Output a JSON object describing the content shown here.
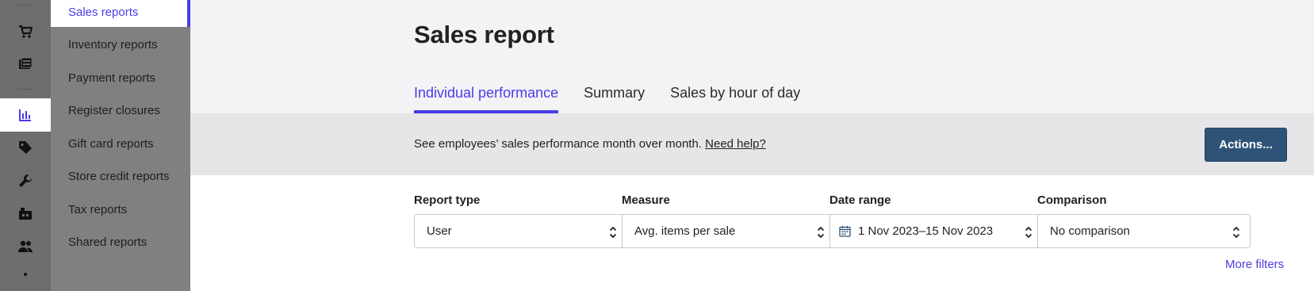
{
  "rail": {
    "icons": [
      "cart-icon",
      "register-icon",
      "reports-icon",
      "tag-icon",
      "wrench-icon",
      "store-icon",
      "people-icon"
    ],
    "active": "reports-icon",
    "accent": "#4a3de6"
  },
  "subnav": {
    "items": [
      {
        "label": "Sales reports",
        "active": true
      },
      {
        "label": "Inventory reports"
      },
      {
        "label": "Payment reports"
      },
      {
        "label": "Register closures"
      },
      {
        "label": "Gift card reports"
      },
      {
        "label": "Store credit reports"
      },
      {
        "label": "Tax reports"
      },
      {
        "label": "Shared reports"
      }
    ]
  },
  "page": {
    "title": "Sales report",
    "tabs": [
      {
        "label": "Individual performance",
        "active": true
      },
      {
        "label": "Summary"
      },
      {
        "label": "Sales by hour of day"
      }
    ]
  },
  "banner": {
    "text": "See employees’ sales performance month over month.",
    "help_link": "Need help?",
    "actions_label": "Actions..."
  },
  "filters": {
    "report_type": {
      "label": "Report type",
      "value": "User"
    },
    "measure": {
      "label": "Measure",
      "value": "Avg. items per sale"
    },
    "date_range": {
      "label": "Date range",
      "value": "1 Nov 2023–15 Nov 2023"
    },
    "comparison": {
      "label": "Comparison",
      "value": "No comparison"
    },
    "more_filters": "More filters"
  },
  "colors": {
    "accent": "#4a3de6",
    "button": "#2f5377"
  }
}
